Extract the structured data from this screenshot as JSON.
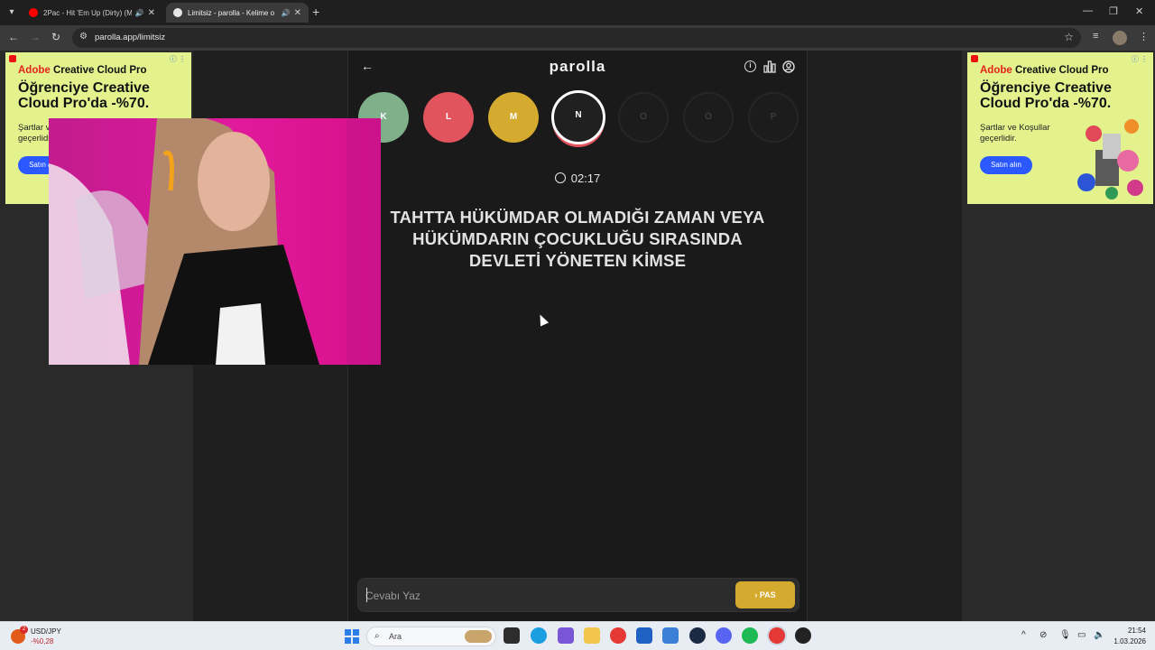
{
  "browser": {
    "tabs": [
      {
        "label": "2Pac - Hit 'Em Up (Dirty) (M",
        "favicon_color": "#ff0000"
      },
      {
        "label": "Limitsiz - parolla - Kelime o",
        "favicon_color": "#e6e6e6",
        "active": true
      }
    ],
    "url": "parolla.app/limitsiz"
  },
  "ads": {
    "left": {
      "brand_prefix": "Adobe",
      "brand_rest": " Creative Cloud Pro",
      "headline": "Öğrenciye Creative Cloud Pro'da -%70.",
      "terms": "Şartlar ve Koşullar geçerlidir.",
      "cta": "Satın alın"
    },
    "right": {
      "brand_prefix": "Adobe",
      "brand_rest": " Creative Cloud Pro",
      "headline": "Öğrenciye Creative Cloud Pro'da -%70.",
      "terms": "Şartlar ve Koşullar geçerlidir.",
      "cta": "Satın alın"
    }
  },
  "game": {
    "logo": "parolla",
    "letters": [
      {
        "char": "K",
        "state": "correct",
        "color": "#7fb08a"
      },
      {
        "char": "L",
        "state": "wrong",
        "color": "#e1535d"
      },
      {
        "char": "M",
        "state": "passed",
        "color": "#d4aa2f"
      },
      {
        "char": "N",
        "state": "current",
        "color": "#202020"
      },
      {
        "char": "O",
        "state": "pending",
        "color": "#1c1c1c"
      },
      {
        "char": "Ö",
        "state": "pending",
        "color": "#1c1c1c"
      },
      {
        "char": "P",
        "state": "pending",
        "color": "#1c1c1c"
      }
    ],
    "timer": "02:17",
    "question": "TAHTTA HÜKÜMDAR OLMADIĞI ZAMAN VEYA HÜKÜMDARIN ÇOCUKLUĞU SIRASINDA DEVLETİ YÖNETEN KİMSE",
    "answer_placeholder": "Cevabı Yaz",
    "pass_label": "PAS"
  },
  "taskbar": {
    "ticker_badge": "2",
    "ticker_name": "USD/JPY",
    "ticker_value": "-%0,28",
    "search_placeholder": "Ara",
    "time": "21:54",
    "date": "1.03.2026"
  }
}
